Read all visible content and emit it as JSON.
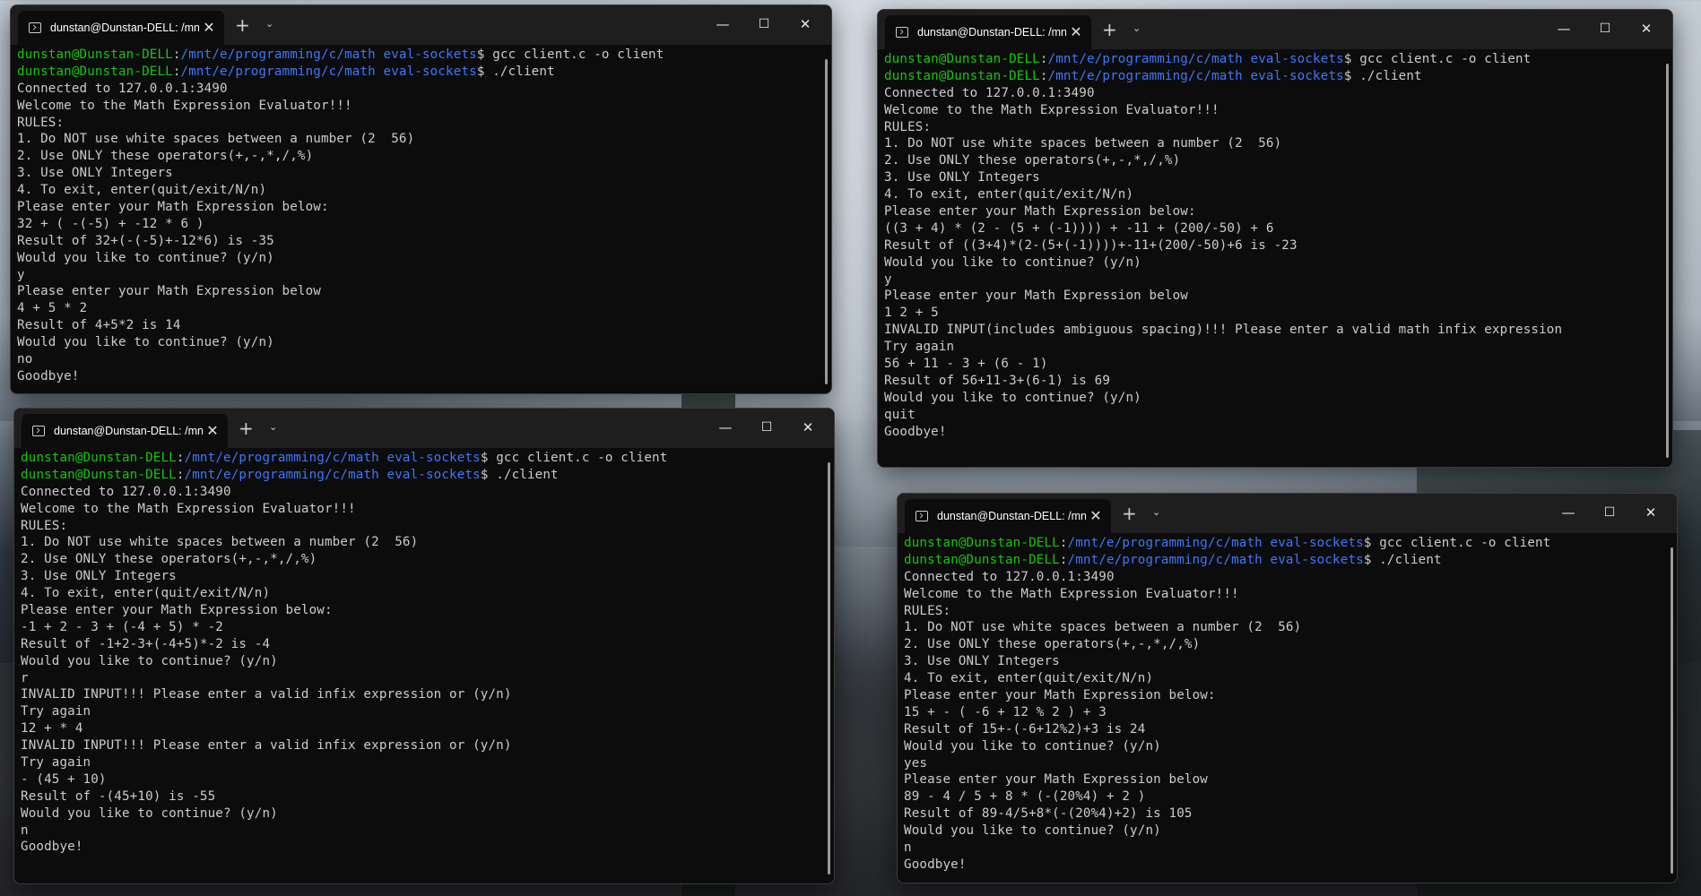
{
  "windows": [
    {
      "tab_title": "dunstan@Dunstan-DELL: /mn",
      "lines": [
        {
          "user": "dunstan@Dunstan-DELL",
          "colon": ":",
          "path": "/mnt/e/programming/c/math eval-sockets",
          "prompt": "$ ",
          "cmd": "gcc client.c -o client"
        },
        {
          "user": "dunstan@Dunstan-DELL",
          "colon": ":",
          "path": "/mnt/e/programming/c/math eval-sockets",
          "prompt": "$ ",
          "cmd": "./client"
        },
        {
          "text": "Connected to 127.0.0.1:3490"
        },
        {
          "text": "Welcome to the Math Expression Evaluator!!!"
        },
        {
          "text": "RULES:"
        },
        {
          "text": "1. Do NOT use white spaces between a number (2  56)"
        },
        {
          "text": "2. Use ONLY these operators(+,-,*,/,%)"
        },
        {
          "text": "3. Use ONLY Integers"
        },
        {
          "text": "4. To exit, enter(quit/exit/N/n)"
        },
        {
          "text": "Please enter your Math Expression below:"
        },
        {
          "text": "32 + ( -(-5) + -12 * 6 )"
        },
        {
          "text": "Result of 32+(-(-5)+-12*6) is -35"
        },
        {
          "text": "Would you like to continue? (y/n)"
        },
        {
          "text": "y"
        },
        {
          "text": "Please enter your Math Expression below"
        },
        {
          "text": "4 + 5 * 2"
        },
        {
          "text": "Result of 4+5*2 is 14"
        },
        {
          "text": "Would you like to continue? (y/n)"
        },
        {
          "text": "no"
        },
        {
          "text": "Goodbye!"
        }
      ]
    },
    {
      "tab_title": "dunstan@Dunstan-DELL: /mn",
      "lines": [
        {
          "user": "dunstan@Dunstan-DELL",
          "colon": ":",
          "path": "/mnt/e/programming/c/math eval-sockets",
          "prompt": "$ ",
          "cmd": "gcc client.c -o client"
        },
        {
          "user": "dunstan@Dunstan-DELL",
          "colon": ":",
          "path": "/mnt/e/programming/c/math eval-sockets",
          "prompt": "$ ",
          "cmd": "./client"
        },
        {
          "text": "Connected to 127.0.0.1:3490"
        },
        {
          "text": "Welcome to the Math Expression Evaluator!!!"
        },
        {
          "text": "RULES:"
        },
        {
          "text": "1. Do NOT use white spaces between a number (2  56)"
        },
        {
          "text": "2. Use ONLY these operators(+,-,*,/,%)"
        },
        {
          "text": "3. Use ONLY Integers"
        },
        {
          "text": "4. To exit, enter(quit/exit/N/n)"
        },
        {
          "text": "Please enter your Math Expression below:"
        },
        {
          "text": "((3 + 4) * (2 - (5 + (-1)))) + -11 + (200/-50) + 6"
        },
        {
          "text": "Result of ((3+4)*(2-(5+(-1))))+-11+(200/-50)+6 is -23"
        },
        {
          "text": "Would you like to continue? (y/n)"
        },
        {
          "text": "y"
        },
        {
          "text": "Please enter your Math Expression below"
        },
        {
          "text": "1 2 + 5"
        },
        {
          "text": "INVALID INPUT(includes ambiguous spacing)!!! Please enter a valid math infix expression"
        },
        {
          "text": "Try again"
        },
        {
          "text": "56 + 11 - 3 + (6 - 1)"
        },
        {
          "text": "Result of 56+11-3+(6-1) is 69"
        },
        {
          "text": "Would you like to continue? (y/n)"
        },
        {
          "text": "quit"
        },
        {
          "text": "Goodbye!"
        }
      ]
    },
    {
      "tab_title": "dunstan@Dunstan-DELL: /mn",
      "lines": [
        {
          "user": "dunstan@Dunstan-DELL",
          "colon": ":",
          "path": "/mnt/e/programming/c/math eval-sockets",
          "prompt": "$ ",
          "cmd": "gcc client.c -o client"
        },
        {
          "user": "dunstan@Dunstan-DELL",
          "colon": ":",
          "path": "/mnt/e/programming/c/math eval-sockets",
          "prompt": "$ ",
          "cmd": "./client"
        },
        {
          "text": "Connected to 127.0.0.1:3490"
        },
        {
          "text": "Welcome to the Math Expression Evaluator!!!"
        },
        {
          "text": "RULES:"
        },
        {
          "text": "1. Do NOT use white spaces between a number (2  56)"
        },
        {
          "text": "2. Use ONLY these operators(+,-,*,/,%)"
        },
        {
          "text": "3. Use ONLY Integers"
        },
        {
          "text": "4. To exit, enter(quit/exit/N/n)"
        },
        {
          "text": "Please enter your Math Expression below:"
        },
        {
          "text": "-1 + 2 - 3 + (-4 + 5) * -2"
        },
        {
          "text": "Result of -1+2-3+(-4+5)*-2 is -4"
        },
        {
          "text": "Would you like to continue? (y/n)"
        },
        {
          "text": "r"
        },
        {
          "text": "INVALID INPUT!!! Please enter a valid infix expression or (y/n)"
        },
        {
          "text": "Try again"
        },
        {
          "text": "12 + * 4"
        },
        {
          "text": "INVALID INPUT!!! Please enter a valid infix expression or (y/n)"
        },
        {
          "text": "Try again"
        },
        {
          "text": "- (45 + 10)"
        },
        {
          "text": "Result of -(45+10) is -55"
        },
        {
          "text": "Would you like to continue? (y/n)"
        },
        {
          "text": "n"
        },
        {
          "text": "Goodbye!"
        }
      ]
    },
    {
      "tab_title": "dunstan@Dunstan-DELL: /mn",
      "lines": [
        {
          "user": "dunstan@Dunstan-DELL",
          "colon": ":",
          "path": "/mnt/e/programming/c/math eval-sockets",
          "prompt": "$ ",
          "cmd": "gcc client.c -o client"
        },
        {
          "user": "dunstan@Dunstan-DELL",
          "colon": ":",
          "path": "/mnt/e/programming/c/math eval-sockets",
          "prompt": "$ ",
          "cmd": "./client"
        },
        {
          "text": "Connected to 127.0.0.1:3490"
        },
        {
          "text": "Welcome to the Math Expression Evaluator!!!"
        },
        {
          "text": "RULES:"
        },
        {
          "text": "1. Do NOT use white spaces between a number (2  56)"
        },
        {
          "text": "2. Use ONLY these operators(+,-,*,/,%)"
        },
        {
          "text": "3. Use ONLY Integers"
        },
        {
          "text": "4. To exit, enter(quit/exit/N/n)"
        },
        {
          "text": "Please enter your Math Expression below:"
        },
        {
          "text": "15 + - ( -6 + 12 % 2 ) + 3"
        },
        {
          "text": "Result of 15+-(-6+12%2)+3 is 24"
        },
        {
          "text": "Would you like to continue? (y/n)"
        },
        {
          "text": "yes"
        },
        {
          "text": "Please enter your Math Expression below"
        },
        {
          "text": "89 - 4 / 5 + 8 * (-(20%4) + 2 )"
        },
        {
          "text": "Result of 89-4/5+8*(-(20%4)+2) is 105"
        },
        {
          "text": "Would you like to continue? (y/n)"
        },
        {
          "text": "n"
        },
        {
          "text": "Goodbye!"
        }
      ]
    }
  ],
  "window_controls": {
    "minimize": "—",
    "maximize": "☐",
    "close": "✕"
  },
  "tab_controls": {
    "close": "✕",
    "new_tab": "+",
    "dropdown": "⌄"
  },
  "colors": {
    "user_green": "#16c60c",
    "path_blue": "#3b78ff",
    "text": "#cccccc",
    "background": "#0c0c0c"
  }
}
